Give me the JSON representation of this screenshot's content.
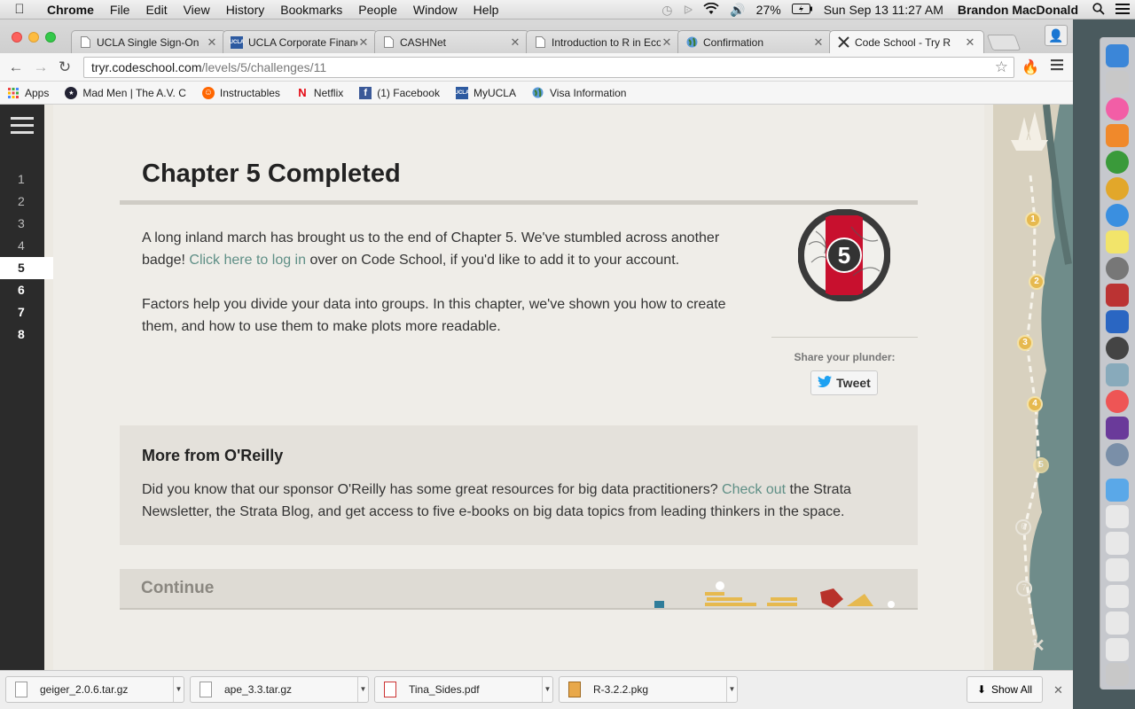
{
  "menubar": {
    "app": "Chrome",
    "items": [
      "File",
      "Edit",
      "View",
      "History",
      "Bookmarks",
      "People",
      "Window",
      "Help"
    ],
    "battery": "27%",
    "datetime": "Sun Sep 13  11:27 AM",
    "user": "Brandon MacDonald"
  },
  "tabs": [
    {
      "title": "UCLA Single Sign-On",
      "icon": "page-icon"
    },
    {
      "title": "UCLA Corporate Financ",
      "icon": "ucla-icon"
    },
    {
      "title": "CASHNet",
      "icon": "page-icon"
    },
    {
      "title": "Introduction to R in Eco",
      "icon": "page-icon"
    },
    {
      "title": "Confirmation",
      "icon": "globe-icon"
    },
    {
      "title": "Code School - Try R",
      "icon": "codeschool-icon"
    }
  ],
  "address": {
    "host": "tryr.codeschool.com",
    "path": "/levels/5/challenges/11"
  },
  "bookmarks": [
    {
      "label": "Apps",
      "icon": "apps-grid-icon",
      "color": "#e44"
    },
    {
      "label": "Mad Men | The A.V. C",
      "icon": "avclub-icon",
      "color": "#223"
    },
    {
      "label": "Instructables",
      "icon": "instructables-icon",
      "color": "#f60"
    },
    {
      "label": "Netflix",
      "icon": "netflix-icon",
      "color": "#e50914"
    },
    {
      "label": "(1) Facebook",
      "icon": "facebook-icon",
      "color": "#3b5998"
    },
    {
      "label": "MyUCLA",
      "icon": "ucla-icon",
      "color": "#2d5aa0"
    },
    {
      "label": "Visa Information",
      "icon": "globe-icon",
      "color": "#4a8ad0"
    }
  ],
  "sidebar": {
    "levels": [
      "1",
      "2",
      "3",
      "4",
      "5",
      "6",
      "7",
      "8"
    ],
    "current": "5"
  },
  "main": {
    "title": "Chapter 5 Completed",
    "para1_before": "A long inland march has brought us to the end of Chapter 5. We've stumbled across another badge! ",
    "para1_link": "Click here to log in",
    "para1_after": " over on Code School, if you'd like to add it to your account.",
    "para2": "Factors help you divide your data into groups. In this chapter, we've shown you how to create them, and how to use them to make plots more readable.",
    "badge_number": "5",
    "share_label": "Share your plunder:",
    "tweet_label": "Tweet"
  },
  "oreilly": {
    "heading": "More from O'Reilly",
    "text_before": "Did you know that our sponsor O'Reilly has some great resources for big data practitioners? ",
    "link": "Check out",
    "text_after": " the Strata Newsletter, the Strata Blog, and get access to five e-books on big data topics from leading thinkers in the space."
  },
  "continue_label": "Continue",
  "map": {
    "markers": [
      "1",
      "2",
      "3",
      "4",
      "5",
      "6",
      "7"
    ]
  },
  "downloads": [
    {
      "name": "geiger_2.0.6.tar.gz"
    },
    {
      "name": "ape_3.3.tar.gz"
    },
    {
      "name": "Tina_Sides.pdf"
    },
    {
      "name": "R-3.2.2.pkg"
    }
  ],
  "show_all": "Show All",
  "colors": {
    "link": "#5f8f86",
    "badge_red": "#c8102e",
    "sidebar": "#2b2b2b"
  }
}
